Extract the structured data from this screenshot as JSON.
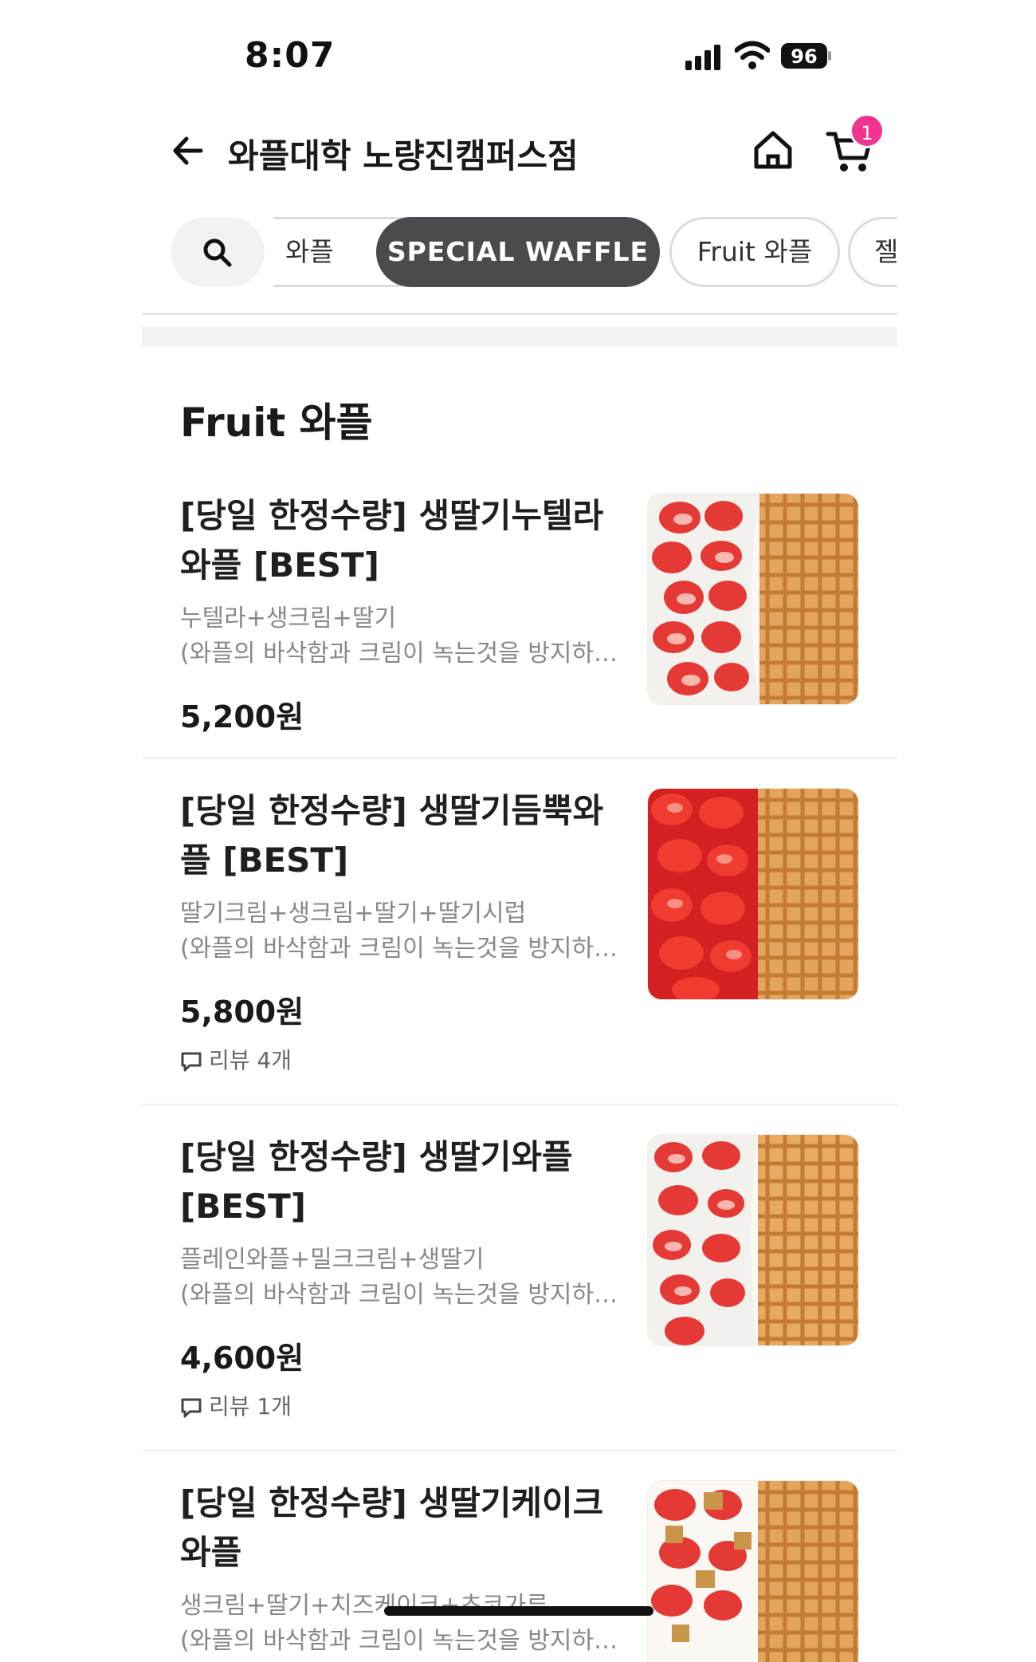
{
  "status_bar": {
    "time": "8:07",
    "battery": "96"
  },
  "header": {
    "title": "와플대학 노량진캠퍼스점",
    "cart_count": "1"
  },
  "categories": [
    {
      "label": "와플",
      "active": false
    },
    {
      "label": "SPECIAL WAFFLE",
      "active": true
    },
    {
      "label": "Fruit 와플",
      "active": false
    },
    {
      "label": "젤",
      "active": false
    }
  ],
  "section": {
    "title": "Fruit 와플"
  },
  "items": [
    {
      "name": "[당일 한정수량] 생딸기누텔라와플 [BEST]",
      "desc1": "누텔라+생크림+딸기",
      "desc2": "(와플의 바삭함과 크림이 녹는것을 방지하…",
      "price": "5,200원",
      "review": ""
    },
    {
      "name": "[당일 한정수량] 생딸기듬뿍와플 [BEST]",
      "desc1": "딸기크림+생크림+딸기+딸기시럽",
      "desc2": "(와플의 바삭함과 크림이 녹는것을 방지하…",
      "price": "5,800원",
      "review": "리뷰 4개"
    },
    {
      "name": "[당일 한정수량] 생딸기와플 [BEST]",
      "desc1": "플레인와플+밀크크림+생딸기",
      "desc2": "(와플의 바삭함과 크림이 녹는것을 방지하…",
      "price": "4,600원",
      "review": "리뷰 1개"
    },
    {
      "name": "[당일 한정수량] 생딸기케이크와플",
      "desc1": "생크림+딸기+치즈케이크+초코가루",
      "desc2": "(와플의 바삭함과 크림이 녹는것을 방지하…",
      "price": "",
      "review": ""
    }
  ]
}
